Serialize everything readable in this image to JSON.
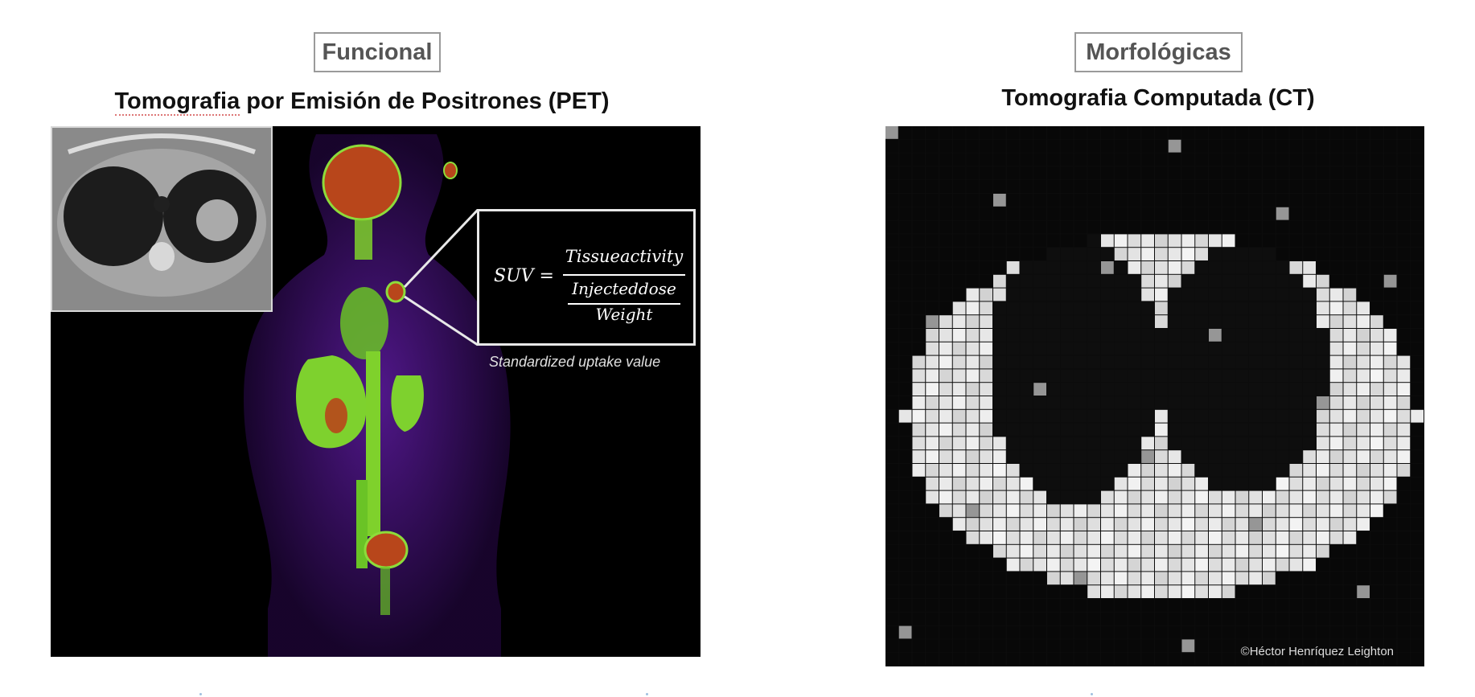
{
  "left": {
    "tag": "Funcional",
    "title_part1": "Tomografia",
    "title_part2": " por Emisión de Positrones (PET)",
    "formula": {
      "lhs": "SUV =",
      "numerator": "Tissueactivity",
      "denominator": "Injecteddose",
      "sub_denominator": "Weight"
    },
    "caption": "Standardized uptake value"
  },
  "right": {
    "tag": "Morfológicas",
    "title": "Tomografia Computada (CT)",
    "copyright": "©Héctor Henríquez Leighton"
  }
}
